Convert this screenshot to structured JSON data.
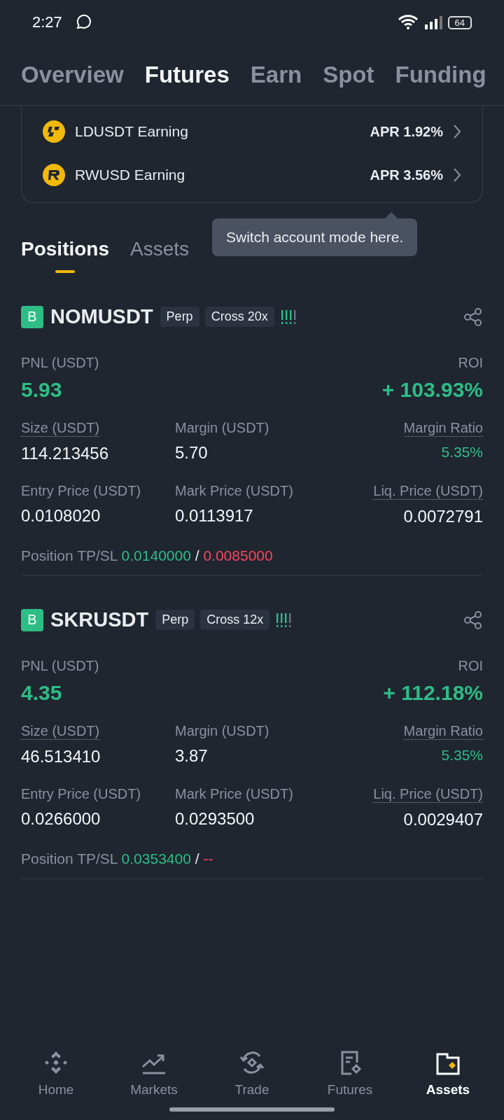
{
  "status_bar": {
    "time": "2:27",
    "battery": "64"
  },
  "top_tabs": [
    {
      "label": "Overview",
      "selected": false
    },
    {
      "label": "Futures",
      "selected": true
    },
    {
      "label": "Earn",
      "selected": false
    },
    {
      "label": "Spot",
      "selected": false
    },
    {
      "label": "Funding",
      "selected": false
    }
  ],
  "earn_rows": [
    {
      "kind": "ld",
      "name": "LDUSDT Earning",
      "apr": "APR 1.92%"
    },
    {
      "kind": "rw",
      "name": "RWUSD Earning",
      "apr": "APR 3.56%"
    }
  ],
  "tooltip": "Switch account mode here.",
  "section_tabs": [
    {
      "label": "Positions",
      "selected": true
    },
    {
      "label": "Assets",
      "selected": false
    }
  ],
  "positions": [
    {
      "side": "B",
      "symbol": "NOMUSDT",
      "tags": [
        "Perp",
        "Cross 20x"
      ],
      "risk": {
        "level": 0.75
      },
      "pnl_label": "PNL (USDT)",
      "pnl": "5.93",
      "roi_label": "ROI",
      "roi": "+ 103.93%",
      "fields": [
        {
          "label": "Size (USDT)",
          "value": "114.213456",
          "dotted": true,
          "positive": false
        },
        {
          "label": "Margin (USDT)",
          "value": "5.70",
          "dotted": false,
          "positive": false
        },
        {
          "label": "Margin Ratio",
          "value": "5.35%",
          "dotted": true,
          "positive": true
        },
        {
          "label": "Entry Price (USDT)",
          "value": "0.0108020",
          "dotted": false,
          "positive": false
        },
        {
          "label": "Mark Price (USDT)",
          "value": "0.0113917",
          "dotted": false,
          "positive": false
        },
        {
          "label": "Liq. Price (USDT)",
          "value": "0.0072791",
          "dotted": true,
          "positive": false
        }
      ],
      "tp_sl": {
        "label": "Position TP/SL",
        "tp": "0.0140000",
        "separator": "/",
        "sl": "0.0085000"
      }
    },
    {
      "side": "B",
      "symbol": "SKRUSDT",
      "tags": [
        "Perp",
        "Cross 12x"
      ],
      "risk": {
        "level": 0.75
      },
      "pnl_label": "PNL (USDT)",
      "pnl": "4.35",
      "roi_label": "ROI",
      "roi": "+ 112.18%",
      "fields": [
        {
          "label": "Size (USDT)",
          "value": "46.513410",
          "dotted": true,
          "positive": false
        },
        {
          "label": "Margin (USDT)",
          "value": "3.87",
          "dotted": false,
          "positive": false
        },
        {
          "label": "Margin Ratio",
          "value": "5.35%",
          "dotted": true,
          "positive": true
        },
        {
          "label": "Entry Price (USDT)",
          "value": "0.0266000",
          "dotted": false,
          "positive": false
        },
        {
          "label": "Mark Price (USDT)",
          "value": "0.0293500",
          "dotted": false,
          "positive": false
        },
        {
          "label": "Liq. Price (USDT)",
          "value": "0.0029407",
          "dotted": true,
          "positive": false
        }
      ],
      "tp_sl": {
        "label": "Position TP/SL",
        "tp": "0.0353400",
        "separator": "/",
        "sl": "--"
      }
    }
  ],
  "bottom_nav": [
    {
      "kind": "home",
      "label": "Home",
      "selected": false
    },
    {
      "kind": "markets",
      "label": "Markets",
      "selected": false
    },
    {
      "kind": "trade",
      "label": "Trade",
      "selected": false
    },
    {
      "kind": "futures",
      "label": "Futures",
      "selected": false
    },
    {
      "kind": "assets",
      "label": "Assets",
      "selected": true
    }
  ]
}
